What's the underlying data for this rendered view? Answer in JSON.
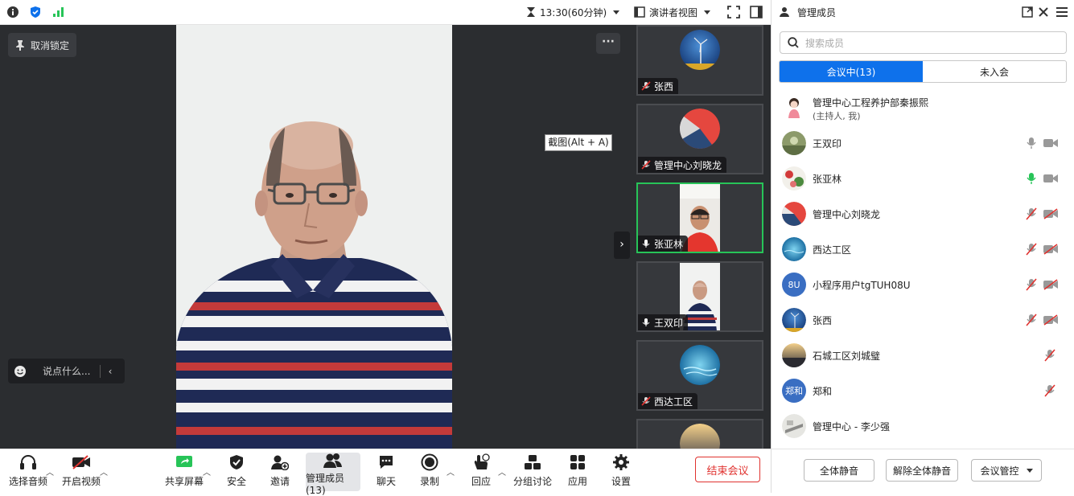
{
  "topbar": {
    "timer": "13:30(60分钟)",
    "view": "演讲者视图"
  },
  "stage": {
    "unlock_label": "取消锁定",
    "more_label": "···",
    "chat_placeholder": "说点什么...",
    "tooltip": "截图(Alt + A)"
  },
  "thumbnails": [
    {
      "name": "张西",
      "audio": "muted"
    },
    {
      "name": "管理中心刘晓龙",
      "audio": "muted"
    },
    {
      "name": "张亚林",
      "audio": "on"
    },
    {
      "name": "王双印",
      "audio": "on"
    },
    {
      "name": "西达工区",
      "audio": "muted"
    }
  ],
  "toolbar": {
    "audio": "选择音频",
    "video": "开启视频",
    "share": "共享屏幕",
    "security": "安全",
    "invite": "邀请",
    "members": "管理成员(13)",
    "chat": "聊天",
    "record": "录制",
    "react": "回应",
    "breakout": "分组讨论",
    "apps": "应用",
    "settings": "设置",
    "end": "结束会议"
  },
  "panel": {
    "title": "管理成员",
    "search_placeholder": "搜索成员",
    "tab_in": "会议中(13)",
    "tab_out": "未入会",
    "members": [
      {
        "name": "管理中心工程养护部秦振熙",
        "sub": "(主持人, 我)",
        "avatar_text": "",
        "mic": "none",
        "video": "none"
      },
      {
        "name": "王双印",
        "avatar_text": "",
        "mic": "off-gray",
        "video": "on-gray"
      },
      {
        "name": "张亚林",
        "avatar_text": "",
        "mic": "talking",
        "video": "on-gray"
      },
      {
        "name": "管理中心刘晓龙",
        "avatar_text": "",
        "mic": "muted",
        "video": "muted"
      },
      {
        "name": "西达工区",
        "avatar_text": "",
        "mic": "muted",
        "video": "muted"
      },
      {
        "name": "小程序用户tgTUH08U",
        "avatar_text": "8U",
        "mic": "muted",
        "video": "muted"
      },
      {
        "name": "张西",
        "avatar_text": "",
        "mic": "muted",
        "video": "muted"
      },
      {
        "name": "石城工区刘城璧",
        "avatar_text": "",
        "mic": "muted",
        "video": "none"
      },
      {
        "name": "郑和",
        "avatar_text": "郑和",
        "mic": "muted",
        "video": "none"
      },
      {
        "name": "管理中心 - 李少强",
        "avatar_text": "",
        "mic": "none",
        "video": "none"
      }
    ],
    "mute_all": "全体静音",
    "unmute_all": "解除全体静音",
    "control": "会议管控"
  },
  "colors": {
    "accent": "#0e71eb",
    "end_red": "#e0322f",
    "active_green": "#27c458",
    "stage_bg": "#2b2d30"
  }
}
